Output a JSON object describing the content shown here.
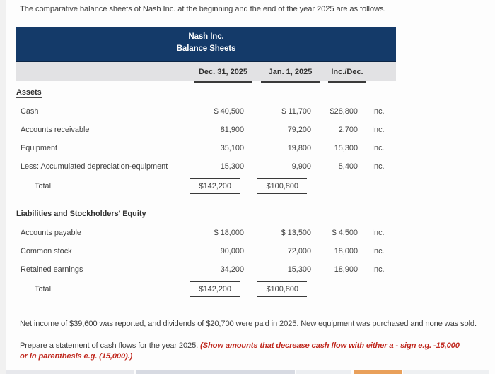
{
  "intro": "The comparative balance sheets of Nash Inc. at the beginning and the end of the year 2025 are as follows.",
  "sheet": {
    "company": "Nash Inc.",
    "subtitle": "Balance Sheets",
    "columns": {
      "label": "",
      "col1": "Dec. 31, 2025",
      "col2": "Jan. 1, 2025",
      "col3": "Inc./Dec.",
      "note": ""
    },
    "sections": [
      {
        "heading": "Assets",
        "rows": [
          {
            "label": "Cash",
            "col1": "$ 40,500",
            "col2": "$ 11,700",
            "col3": "$28,800",
            "note": "Inc."
          },
          {
            "label": "Accounts receivable",
            "col1": "81,900",
            "col2": "79,200",
            "col3": "2,700",
            "note": "Inc."
          },
          {
            "label": "Equipment",
            "col1": "35,100",
            "col2": "19,800",
            "col3": "15,300",
            "note": "Inc."
          },
          {
            "label": "Less: Accumulated depreciation-equipment",
            "col1": "15,300",
            "col2": "9,900",
            "col3": "5,400",
            "note": "Inc."
          }
        ],
        "total": {
          "label": "Total",
          "col1": "$142,200",
          "col2": "$100,800",
          "col3": "",
          "note": ""
        }
      },
      {
        "heading": "Liabilities and Stockholders' Equity",
        "rows": [
          {
            "label": "Accounts payable",
            "col1": "$ 18,000",
            "col2": "$ 13,500",
            "col3": "$ 4,500",
            "note": "Inc."
          },
          {
            "label": "Common stock",
            "col1": "90,000",
            "col2": "72,000",
            "col3": "18,000",
            "note": "Inc."
          },
          {
            "label": "Retained earnings",
            "col1": "34,200",
            "col2": "15,300",
            "col3": "18,900",
            "note": "Inc."
          }
        ],
        "total": {
          "label": "Total",
          "col1": "$142,200",
          "col2": "$100,800",
          "col3": "",
          "note": ""
        }
      }
    ]
  },
  "footnote": "Net income of $39,600 was reported, and dividends of $20,700 were paid in 2025. New equipment was purchased and none was sold.",
  "prompt": {
    "lead": "Prepare a statement of cash flows for the year 2025. ",
    "hint": "(Show amounts that decrease cash flow with either a - sign e.g. -15,000 or in parenthesis e.g. (15,000).)"
  },
  "colors": {
    "header_navy": "#143a69",
    "column_band_grey": "#e2e2e4",
    "hint_red": "#c0281e",
    "accent_orange": "#e9a05b"
  }
}
